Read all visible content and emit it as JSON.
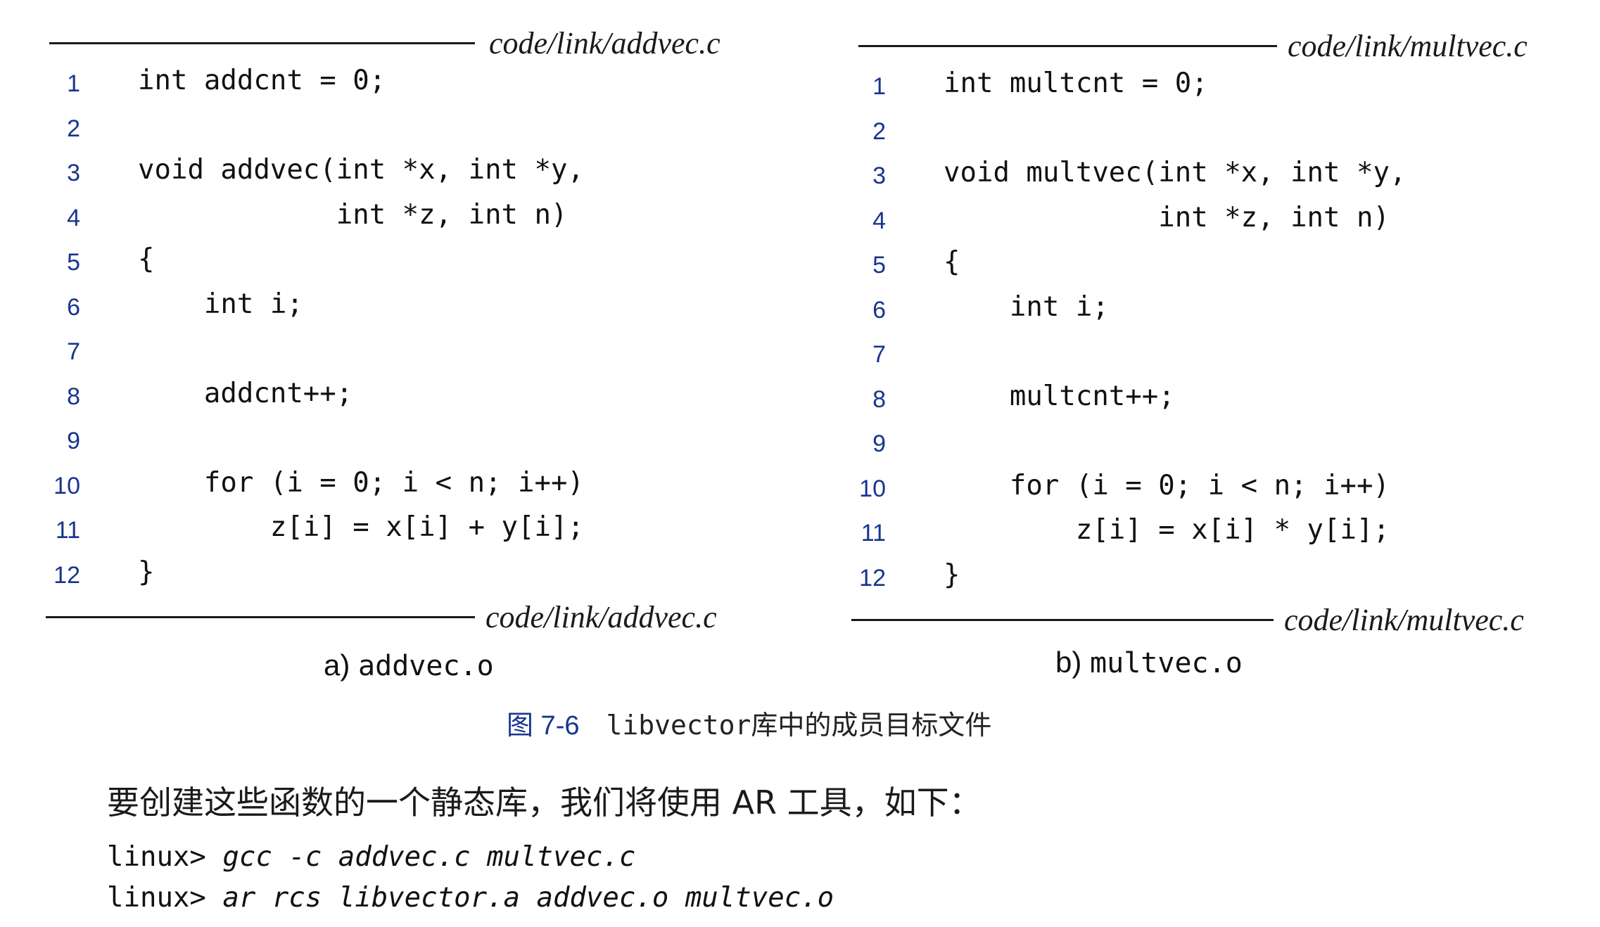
{
  "listing_a": {
    "filename": "code/link/addvec.c",
    "lines": [
      {
        "num": "1",
        "code": "int addcnt = 0;"
      },
      {
        "num": "2",
        "code": ""
      },
      {
        "num": "3",
        "code": "void addvec(int *x, int *y,"
      },
      {
        "num": "4",
        "code": "            int *z, int n)"
      },
      {
        "num": "5",
        "code": "{"
      },
      {
        "num": "6",
        "code": "    int i;"
      },
      {
        "num": "7",
        "code": ""
      },
      {
        "num": "8",
        "code": "    addcnt++;"
      },
      {
        "num": "9",
        "code": ""
      },
      {
        "num": "10",
        "code": "    for (i = 0; i < n; i++)"
      },
      {
        "num": "11",
        "code": "        z[i] = x[i] + y[i];"
      },
      {
        "num": "12",
        "code": "}"
      }
    ],
    "caption_prefix": "a)",
    "caption_name": "addvec.o"
  },
  "listing_b": {
    "filename": "code/link/multvec.c",
    "lines": [
      {
        "num": "1",
        "code": "int multcnt = 0;"
      },
      {
        "num": "2",
        "code": ""
      },
      {
        "num": "3",
        "code": "void multvec(int *x, int *y,"
      },
      {
        "num": "4",
        "code": "             int *z, int n)"
      },
      {
        "num": "5",
        "code": "{"
      },
      {
        "num": "6",
        "code": "    int i;"
      },
      {
        "num": "7",
        "code": ""
      },
      {
        "num": "8",
        "code": "    multcnt++;"
      },
      {
        "num": "9",
        "code": ""
      },
      {
        "num": "10",
        "code": "    for (i = 0; i < n; i++)"
      },
      {
        "num": "11",
        "code": "        z[i] = x[i] * y[i];"
      },
      {
        "num": "12",
        "code": "}"
      }
    ],
    "caption_prefix": "b)",
    "caption_name": "multvec.o"
  },
  "figure": {
    "number": "图 7-6",
    "caption_code": "libvector",
    "caption_text": "库中的成员目标文件"
  },
  "body_text": "要创建这些函数的一个静态库，我们将使用 AR 工具，如下：",
  "shell_lines": [
    {
      "prompt": "linux> ",
      "command": "gcc -c addvec.c multvec.c"
    },
    {
      "prompt": "linux> ",
      "command": "ar rcs libvector.a addvec.o multvec.o"
    }
  ],
  "colors": {
    "line_number": "#17358f",
    "text": "#1a1a1a"
  }
}
